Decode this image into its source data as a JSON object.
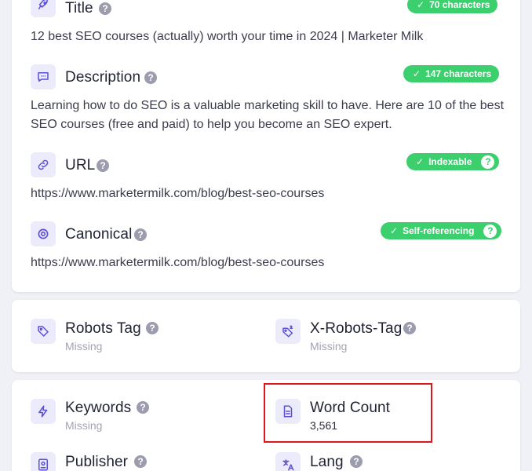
{
  "title": {
    "label": "Title",
    "badge": "70 characters",
    "value": "12 best SEO courses (actually) worth your time in 2024 | Marketer Milk",
    "icon": "rocket-icon"
  },
  "description": {
    "label": "Description",
    "badge": "147 characters",
    "value_line1": "Learning how to do SEO is a valuable marketing skill to have. Here are 10 of the best",
    "value_line2": "SEO courses (free and paid) to help you become an SEO expert.",
    "icon": "message-icon"
  },
  "url": {
    "label": "URL",
    "badge": "Indexable",
    "value": "https://www.marketermilk.com/blog/best-seo-courses",
    "icon": "link-icon"
  },
  "canonical": {
    "label": "Canonical",
    "badge": "Self-referencing",
    "value": "https://www.marketermilk.com/blog/best-seo-courses",
    "icon": "target-icon"
  },
  "robots_tag": {
    "label": "Robots Tag",
    "status": "Missing",
    "icon": "tag-icon"
  },
  "x_robots_tag": {
    "label": "X-Robots-Tag",
    "status": "Missing",
    "icon": "tag-x-icon"
  },
  "keywords": {
    "label": "Keywords",
    "status": "Missing",
    "icon": "bolt-icon"
  },
  "word_count": {
    "label": "Word Count",
    "value": "3,561",
    "icon": "document-icon"
  },
  "publisher": {
    "label": "Publisher",
    "icon": "publisher-icon"
  },
  "lang": {
    "label": "Lang",
    "icon": "translate-icon"
  },
  "help_glyph": "?",
  "check_glyph": "✓",
  "colors": {
    "accent": "#5b4fd6",
    "icon_bg": "#ecebfb",
    "success": "#3ccf6e",
    "muted": "#a2a4b3",
    "highlight": "#e0161c"
  }
}
